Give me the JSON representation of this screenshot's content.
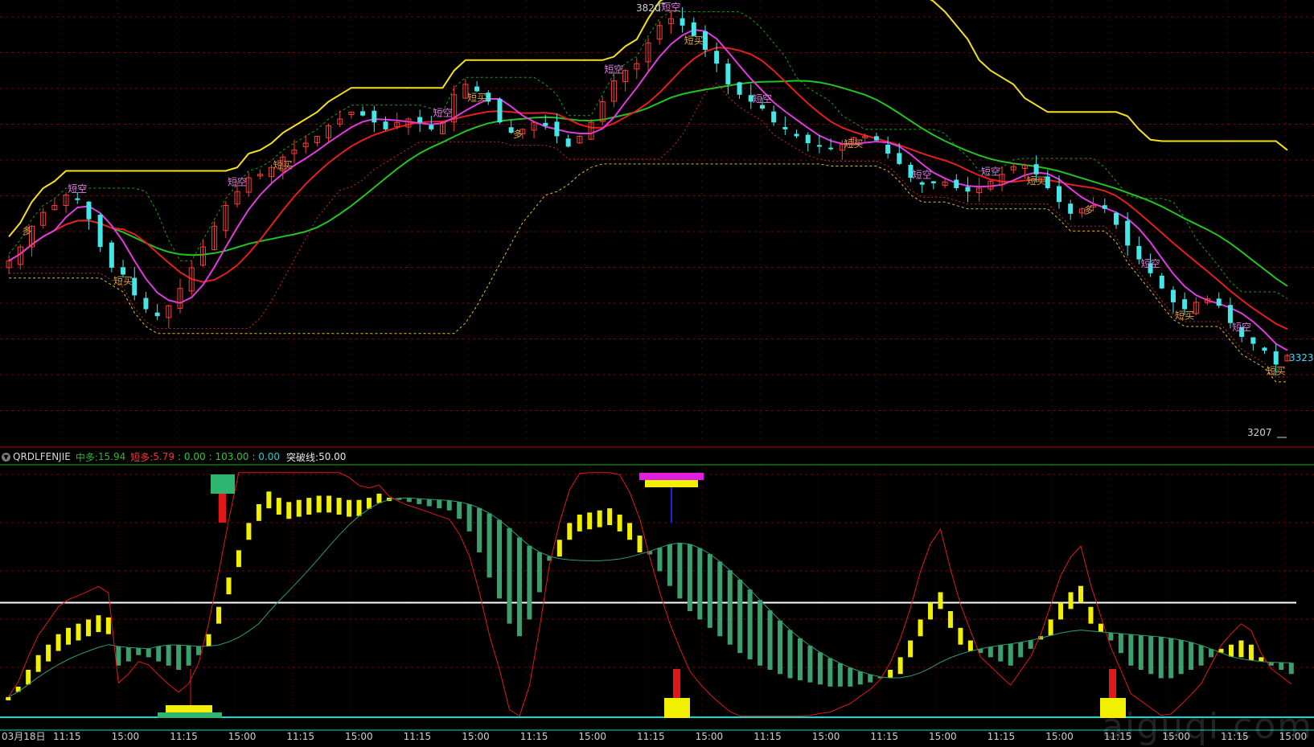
{
  "colors": {
    "background": "#000000",
    "grid": "#7a0000",
    "up_candle": "#ff3b3b",
    "down_candle": "#46e6e6",
    "ma_green": "#22c322",
    "ma_red": "#e51e1e",
    "ma_magenta": "#e03be0",
    "upper_band": "#f2e11c",
    "lower_dashed": "#e6c02a",
    "stop_dashed": "#c82828",
    "panel_border": "#c00000",
    "zero_line": "#00dddd",
    "mid_line": "#ffffff",
    "top_line": "#1eab1e",
    "yellow_bar": "#f0f000",
    "teal_bar": "#3d9e6e",
    "osc_red": "#e21818",
    "osc_signal": "#2f9d72"
  },
  "price_labels": {
    "high": "3820",
    "current": "3323",
    "low": "3207"
  },
  "short_labels": {
    "short_empty": "短空",
    "short_buy": "短买",
    "long": "多"
  },
  "indicator": {
    "name": "QRDLFENJIE",
    "mid_long_label": "中多:",
    "mid_long_value": "15.94",
    "short_long_label": "短多:",
    "short_long_value": "5.79",
    "v3": ": 0.00",
    "v4": ": 103.00",
    "v5": ": 0.00",
    "breakout_label": "突破线:",
    "breakout_value": "50.00"
  },
  "x_axis": {
    "first": "03月18日",
    "ticks": [
      "11:15",
      "15:00",
      "11:15",
      "15:00",
      "11:15",
      "15:00",
      "11:15",
      "15:00",
      "11:15",
      "15:00",
      "11:15",
      "15:00",
      "11:15",
      "15:00",
      "11:15",
      "15:00",
      "11:15",
      "15:00",
      "11:15",
      "15:00",
      "11:15",
      "15:00"
    ]
  },
  "watermark": "aiguqi.com",
  "chart_data": [
    {
      "type": "candlestick",
      "title": "",
      "ylim": [
        3200,
        3830
      ],
      "annotations": {
        "high": 3820,
        "current": 3323,
        "low": 3207
      },
      "close_series": [
        3460,
        3480,
        3510,
        3530,
        3540,
        3555,
        3550,
        3520,
        3480,
        3450,
        3440,
        3410,
        3390,
        3380,
        3395,
        3420,
        3450,
        3480,
        3510,
        3540,
        3560,
        3580,
        3585,
        3595,
        3610,
        3620,
        3630,
        3640,
        3655,
        3665,
        3675,
        3670,
        3660,
        3650,
        3660,
        3665,
        3660,
        3650,
        3660,
        3700,
        3715,
        3705,
        3690,
        3660,
        3645,
        3650,
        3660,
        3655,
        3640,
        3625,
        3640,
        3660,
        3690,
        3720,
        3735,
        3745,
        3775,
        3800,
        3810,
        3800,
        3785,
        3765,
        3745,
        3715,
        3700,
        3690,
        3680,
        3660,
        3650,
        3640,
        3630,
        3625,
        3622,
        3628,
        3638,
        3640,
        3634,
        3615,
        3600,
        3580,
        3570,
        3572,
        3574,
        3565,
        3560,
        3565,
        3575,
        3585,
        3596,
        3598,
        3585,
        3565,
        3545,
        3528,
        3535,
        3540,
        3535,
        3512,
        3482,
        3462,
        3442,
        3420,
        3400,
        3390,
        3400,
        3405,
        3395,
        3370,
        3350,
        3340,
        3330,
        3310,
        3323
      ]
    },
    {
      "type": "oscillator",
      "title": "QRDLFENJIE",
      "ylim": [
        -5,
        115
      ],
      "breakout_line": 50,
      "series": [
        {
          "name": "中多",
          "last": 15.94
        },
        {
          "name": "短多",
          "last": 5.79
        }
      ],
      "histogram": [
        5,
        10,
        18,
        25,
        30,
        35,
        38,
        40,
        42,
        44,
        43,
        20,
        22,
        25,
        24,
        22,
        20,
        18,
        20,
        25,
        35,
        48,
        62,
        75,
        88,
        97,
        103,
        100,
        98,
        99,
        100,
        101,
        101,
        100,
        99,
        99,
        100,
        102,
        100,
        99,
        98,
        97,
        96,
        95,
        94,
        90,
        84,
        74,
        62,
        52,
        40,
        34,
        42,
        55,
        70,
        80,
        88,
        92,
        93,
        94,
        95,
        92,
        88,
        82,
        73,
        65,
        58,
        52,
        46,
        42,
        38,
        34,
        30,
        26,
        23,
        20,
        18,
        16,
        14,
        13,
        12,
        11,
        10,
        10,
        10,
        11,
        12,
        14,
        18,
        24,
        32,
        42,
        50,
        55,
        46,
        38,
        32,
        26,
        24,
        22,
        20,
        24,
        28,
        34,
        42,
        50,
        55,
        58,
        48,
        40,
        32,
        26,
        20,
        18,
        16,
        14,
        14,
        16,
        18,
        20,
        24,
        28,
        30,
        32,
        30,
        24,
        20,
        18,
        16
      ]
    }
  ]
}
